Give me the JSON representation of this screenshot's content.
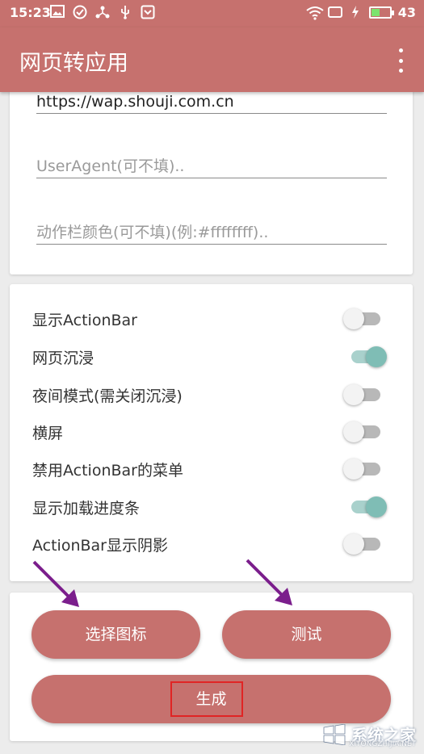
{
  "status_bar": {
    "time": "15:23",
    "battery_level": "43",
    "icons": [
      "image-icon",
      "check-circle-icon",
      "network-icon",
      "usb-icon",
      "shield-icon",
      "wifi-icon",
      "screen-icon",
      "charging-icon",
      "battery-icon"
    ]
  },
  "app_bar": {
    "title": "网页转应用",
    "color": "#c6716e"
  },
  "inputs": {
    "url_value": "https://wap.shouji.com.cn",
    "useragent_placeholder": "UserAgent(可不填)..",
    "actionbar_color_placeholder": "动作栏颜色(可不填)(例:#ffffffff).."
  },
  "toggles": [
    {
      "label": "显示ActionBar",
      "on": false
    },
    {
      "label": "网页沉浸",
      "on": true
    },
    {
      "label": "夜间模式(需关闭沉浸)",
      "on": false
    },
    {
      "label": "横屏",
      "on": false
    },
    {
      "label": "禁用ActionBar的菜单",
      "on": false
    },
    {
      "label": "显示加载进度条",
      "on": true
    },
    {
      "label": "ActionBar显示阴影",
      "on": false
    }
  ],
  "buttons": {
    "choose_icon": "选择图标",
    "test": "测试",
    "generate": "生成"
  },
  "watermark": {
    "text": "系统之家",
    "sub": "XITONGZHIJIA.NET"
  },
  "colors": {
    "accent": "#c6716e",
    "switch_on": "#7fbdb5",
    "annotation_arrow": "#7b1e8c",
    "highlight_box": "#e02424"
  }
}
